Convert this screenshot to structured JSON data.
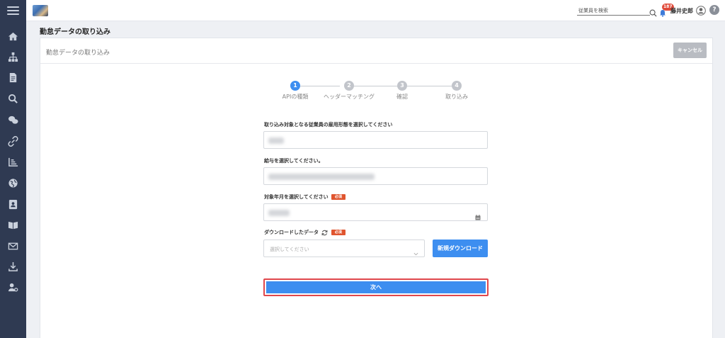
{
  "topbar": {
    "search_placeholder": "従業員を検索",
    "notification_count": "187",
    "username": "藤井史郎",
    "help_label": "?"
  },
  "sidebar": {
    "items": [
      {
        "icon": "home-icon"
      },
      {
        "icon": "org-chart-icon"
      },
      {
        "icon": "document-icon"
      },
      {
        "icon": "search-icon"
      },
      {
        "icon": "chat-icon"
      },
      {
        "icon": "link-icon"
      },
      {
        "icon": "chart-icon"
      },
      {
        "icon": "globe-icon"
      },
      {
        "icon": "contact-card-icon"
      },
      {
        "icon": "book-icon"
      },
      {
        "icon": "mail-icon"
      },
      {
        "icon": "download-icon"
      },
      {
        "icon": "user-settings-icon"
      }
    ]
  },
  "page": {
    "title": "勤怠データの取り込み",
    "card_title": "勤怠データの取り込み",
    "cancel_label": "キャンセル"
  },
  "stepper": {
    "steps": [
      {
        "number": "1",
        "label": "APIの種類",
        "active": true
      },
      {
        "number": "2",
        "label": "ヘッダーマッチング",
        "active": false
      },
      {
        "number": "3",
        "label": "確認",
        "active": false
      },
      {
        "number": "4",
        "label": "取り込み",
        "active": false
      }
    ]
  },
  "form": {
    "employment_label": "取り込み対象となる従業員の雇用形態を選択してください",
    "salary_label": "給与を選択してください。",
    "month_label": "対象年月を選択してください",
    "download_label": "ダウンロードしたデータ",
    "required_badge": "必須",
    "download_select_placeholder": "選択してください",
    "new_download_label": "新規ダウンロード",
    "next_label": "次へ"
  },
  "colors": {
    "sidebar": "#2f3a52",
    "primary": "#3d8ef0",
    "required": "#e0552f",
    "highlight_border": "#e0474c"
  }
}
